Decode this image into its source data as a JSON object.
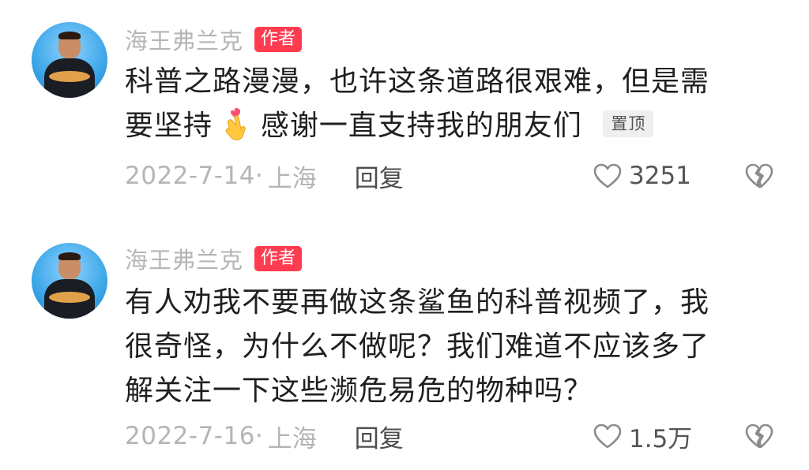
{
  "comments": [
    {
      "author": "海王弗兰克",
      "author_badge": "作者",
      "text_line1": "科普之路漫漫，也许这条道路很艰难，但是需",
      "text_line2_a": "要坚持",
      "text_line2_b": "感谢一直支持我的朋友们",
      "pin_label": "置顶",
      "date": "2022-7-14",
      "separator": "·",
      "location": "上海",
      "reply_label": "回复",
      "like_count": "3251"
    },
    {
      "author": "海王弗兰克",
      "author_badge": "作者",
      "text_line1": "有人劝我不要再做这条鲨鱼的科普视频了，我",
      "text_line2": "很奇怪，为什么不做呢？我们难道不应该多了",
      "text_line3": "解关注一下这些濒危易危的物种吗？",
      "date": "2022-7-16",
      "separator": "·",
      "location": "上海",
      "reply_label": "回复",
      "like_count": "1.5万"
    }
  ],
  "icons": {
    "like": "heart-outline-icon",
    "dislike": "broken-heart-icon",
    "emoji": "finger-heart-emoji"
  },
  "colors": {
    "author_badge_bg": "#ff3b4f",
    "muted_text": "#b5b5b5",
    "body_text": "#1f1f1f",
    "pin_bg": "#efefef"
  }
}
